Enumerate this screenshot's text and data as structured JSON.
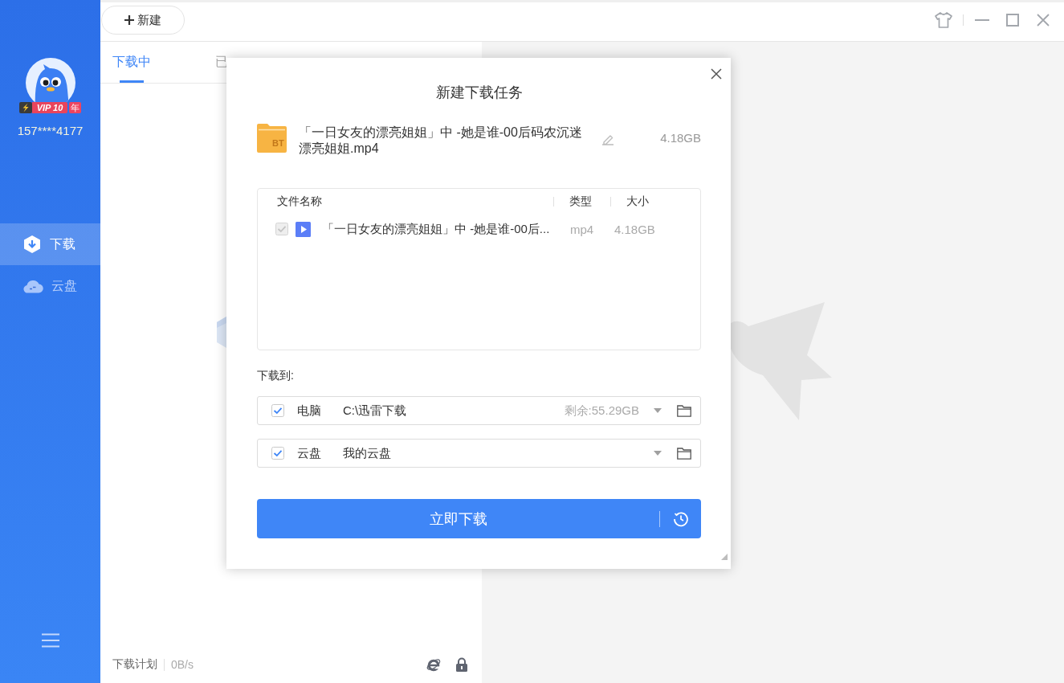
{
  "sidebar": {
    "user": {
      "vip_level": "VIP 10",
      "vip_unit": "年",
      "phone": "157****4177"
    },
    "nav": [
      {
        "label": "下载",
        "selected": true
      },
      {
        "label": "云盘",
        "selected": false
      }
    ]
  },
  "toolbar": {
    "new_button": "新建"
  },
  "tabs": [
    {
      "label": "下载中",
      "selected": true
    },
    {
      "label": "已",
      "selected": false
    }
  ],
  "status_bar": {
    "plan": "下载计划",
    "speed": "0B/s"
  },
  "dialog": {
    "title": "新建下载任务",
    "file": {
      "icon_label": "BT",
      "name": "「一日女友的漂亮姐姐」中 -她是谁-00后码农沉迷漂亮姐姐.mp4",
      "size": "4.18GB"
    },
    "table": {
      "columns": [
        "文件名称",
        "类型",
        "大小"
      ],
      "rows": [
        {
          "checked": true,
          "disabled": true,
          "name": "「一日女友的漂亮姐姐」中 -她是谁-00后...",
          "type": "mp4",
          "size": "4.18GB"
        }
      ]
    },
    "save_to_label": "下载到:",
    "destinations": [
      {
        "checked": true,
        "label": "电脑",
        "path": "C:\\迅雷下载",
        "free_space": "剩余:55.29GB"
      },
      {
        "checked": true,
        "label": "云盘",
        "path": "我的云盘"
      }
    ],
    "download_button": "立即下载"
  }
}
